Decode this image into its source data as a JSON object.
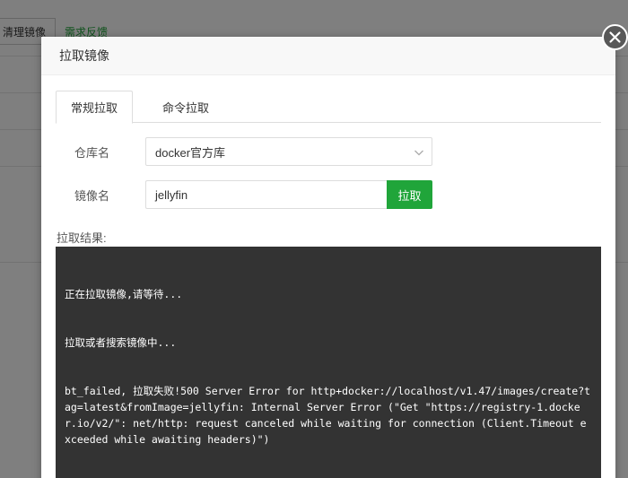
{
  "background": {
    "toolbar": {
      "clean_images_label": "清理镜像",
      "feedback_label": "需求反馈"
    }
  },
  "modal": {
    "title": "拉取镜像",
    "tabs": [
      {
        "label": "常规拉取",
        "active": true
      },
      {
        "label": "命令拉取",
        "active": false
      }
    ],
    "repository": {
      "label": "仓库名",
      "value": "docker官方库"
    },
    "image": {
      "label": "镜像名",
      "value": "jellyfin",
      "pull_label": "拉取"
    },
    "result": {
      "label": "拉取结果:",
      "lines": [
        "正在拉取镜像,请等待...",
        "拉取或者搜索镜像中...",
        "bt_failed, 拉取失败!500 Server Error for http+docker://localhost/v1.47/images/create?tag=latest&fromImage=jellyfin: Internal Server Error (\"Get \"https://registry-1.docker.io/v2/\": net/http: request canceled while waiting for connection (Client.Timeout exceeded while awaiting headers)\")"
      ]
    }
  },
  "colors": {
    "accent": "#20a53a",
    "console_bg": "#333333",
    "close_bg": "#585858"
  },
  "icons": {
    "close": "close-icon",
    "dropdown": "chevron-down-icon"
  }
}
